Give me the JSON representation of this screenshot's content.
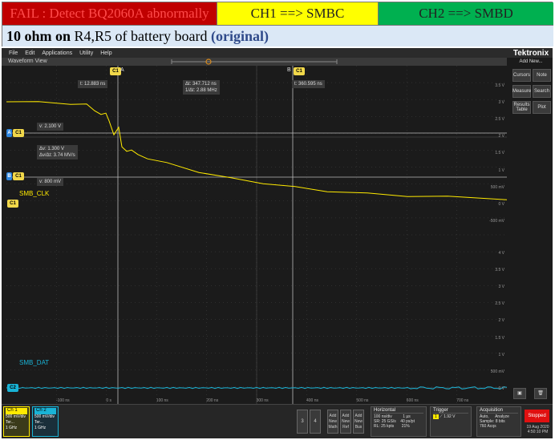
{
  "header": {
    "fail_text": "FAIL : Detect BQ2060A abnormally",
    "ch1_text": "CH1 ==> SMBC",
    "ch2_text": "CH2 ==> SMBD",
    "sub_part1": "10 ohm on",
    "sub_part2": " R4,R5 of battery board ",
    "sub_part3": "(original)"
  },
  "scope": {
    "menu": [
      "File",
      "Edit",
      "Applications",
      "Utility",
      "Help"
    ],
    "waveform_view": "Waveform View",
    "brand": "Tektronix",
    "add_new": "Add New...",
    "buttons": {
      "cursors": "Cursors",
      "note": "Note",
      "measure": "Measure",
      "search": "Search",
      "results_table": "Results Table",
      "plot": "Plot"
    },
    "ch1_label": "SMB_CLK",
    "ch2_label": "SMB_DAT",
    "cursor_a_label": "A",
    "cursor_b_label": "B",
    "readouts": {
      "t_a": "t: 12.883 ns",
      "dt": "Δt: 347.712 ns",
      "inv_dt": "1/Δt: 2.88 MHz",
      "t_b": "t: 360.595 ns",
      "v_a": "v: 2.100 V",
      "dv": "Δv: 1.300 V",
      "dv_dt": "Δv/Δt: 3.74 MV/s",
      "v_b": "v: 800 mV"
    },
    "tags": {
      "a": "A",
      "b": "B",
      "c1": "C1",
      "c2": "C2"
    },
    "ch1_scale": [
      "3.5 V",
      "3 V",
      "2.5 V",
      "2 V",
      "1.5 V",
      "1 V",
      "500 mV",
      "0 V",
      "-500 mV"
    ],
    "ch2_scale": [
      "4 V",
      "3.5 V",
      "3 V",
      "2.5 V",
      "2 V",
      "1.5 V",
      "1 V",
      "500 mV",
      "0 V"
    ],
    "time_ticks": [
      "-100 ns",
      "0 s",
      "100 ns",
      "200 ns",
      "300 ns",
      "400 ns",
      "500 ns",
      "600 ns",
      "700 ns"
    ]
  },
  "bottom": {
    "ch1": {
      "title": "Ch 1",
      "l1": "500 mV/div",
      "l2": "Ter...",
      "l3": "1 GHz"
    },
    "ch2": {
      "title": "Ch 2",
      "l1": "500 mV/div",
      "l2": "Ter...",
      "l3": "1 GHz"
    },
    "btn3": "3",
    "btn4": "4",
    "add_math": "Add New Math",
    "add_ref": "Add New Ref",
    "add_bus": "Add New Bus",
    "horizontal": {
      "title": "Horizontal",
      "l1": "100 ns/div",
      "l1b": "1 µs",
      "l2": "SR: 25 GS/s",
      "l2b": "40 ps/pt",
      "l3": "RL: 25 kpts",
      "l3b": "21%"
    },
    "trigger": {
      "title": "Trigger",
      "l1": "1.92 V"
    },
    "acquisition": {
      "title": "Acquisition",
      "l1": "Auto,",
      "l1b": "Analyze",
      "l2": "Sample: 8 bits",
      "l3": "760 Acqs"
    },
    "stopped": "Stopped",
    "date": "19 Aug 2020",
    "time": "4:50:10 PM"
  },
  "colors": {
    "ch1": "#ffea00",
    "ch2": "#19b3d6",
    "fail_bg": "#c00000",
    "ch1_bg": "#ffff00",
    "ch2_bg": "#00b050"
  }
}
